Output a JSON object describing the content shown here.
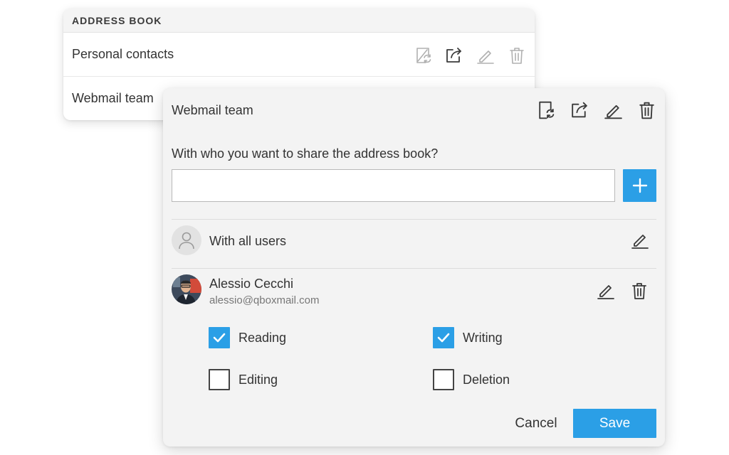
{
  "address_book": {
    "header": "ADDRESS BOOK",
    "rows": [
      {
        "label": "Personal contacts"
      },
      {
        "label": "Webmail team"
      }
    ]
  },
  "share_panel": {
    "title": "Webmail team",
    "question": "With who you want to share the address book?",
    "input_value": "",
    "input_placeholder": "",
    "all_users": {
      "label": "With all users"
    },
    "user": {
      "name": "Alessio Cecchi",
      "email": "alessio@qboxmail.com"
    },
    "permissions": [
      {
        "label": "Reading",
        "checked": true
      },
      {
        "label": "Writing",
        "checked": true
      },
      {
        "label": "Editing",
        "checked": false
      },
      {
        "label": "Deletion",
        "checked": false
      }
    ],
    "cancel_label": "Cancel",
    "save_label": "Save"
  },
  "icons": [
    "sync-icon",
    "share-icon",
    "edit-icon",
    "trash-icon",
    "plus-icon",
    "user-icon",
    "checkmark-icon"
  ],
  "colors": {
    "accent": "#2b9fe6",
    "panel_background": "#f3f3f3"
  }
}
